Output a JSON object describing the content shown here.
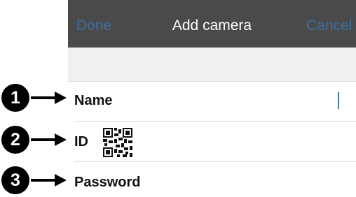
{
  "navbar": {
    "done_label": "Done",
    "title": "Add camera",
    "cancel_label": "Cancel"
  },
  "fields": [
    {
      "number": "1",
      "label": "Name"
    },
    {
      "number": "2",
      "label": "ID"
    },
    {
      "number": "3",
      "label": "Password"
    }
  ],
  "colors": {
    "navbar_bg": "#4a4a4a",
    "nav_button_text": "#3f6e9e",
    "nav_title_text": "#ffffff",
    "callout_circle": "#000000",
    "cursor": "#46759f"
  }
}
